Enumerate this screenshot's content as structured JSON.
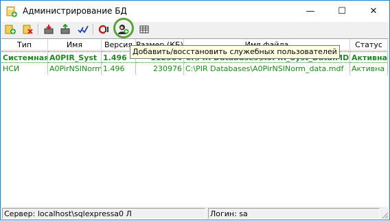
{
  "window": {
    "title": "Администрирование БД",
    "controls": {
      "minimize": "—",
      "maximize": "☐",
      "close": "✕"
    }
  },
  "toolbar": {
    "buttons": [
      {
        "icon": "add-database-icon"
      },
      {
        "icon": "delete-database-icon"
      },
      {
        "icon": "import-icon"
      },
      {
        "icon": "export-icon"
      },
      {
        "icon": "check-icon"
      },
      {
        "icon": "reset-icon"
      },
      {
        "icon": "add-users-icon",
        "highlighted": true
      },
      {
        "icon": "table-icon"
      }
    ],
    "tooltip": "Добавить/восстановить служебных пользователей"
  },
  "table": {
    "columns": [
      "Тип",
      "Имя",
      "Версия",
      "Размер (КБ)",
      "Имя файла",
      "Статус"
    ],
    "rows": [
      [
        "Системная",
        "A0PIR_Syst",
        "1.496",
        "112384",
        "C:\\PIR Databases\\A0PIR_Syst_Data.MDF",
        "Активна"
      ],
      [
        "НСИ",
        "A0PirNSINorm",
        "1.496",
        "230976",
        "C:\\PIR Databases\\A0PirNSINorm_data.mdf",
        "Активна"
      ]
    ]
  },
  "status": {
    "server": "Сервер: localhost\\sqlexpressa0 Л",
    "login": "Логин: sa"
  },
  "colors": {
    "active_row": "#218a21",
    "tooltip_bg": "#ffffe1",
    "highlight_ring": "#5aa33b"
  }
}
